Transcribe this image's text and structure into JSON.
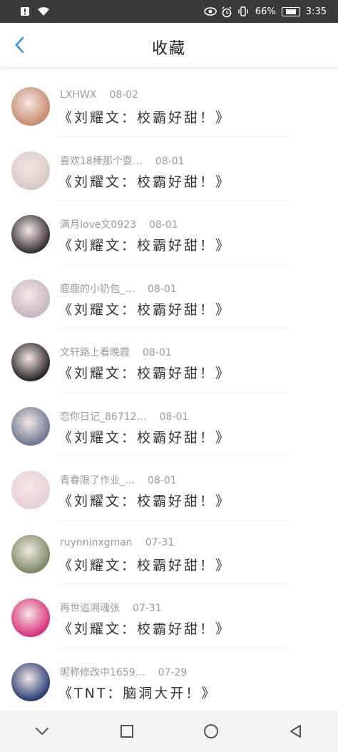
{
  "status_bar": {
    "battery_percent": "66%",
    "time": "3:35"
  },
  "header": {
    "title": "收藏"
  },
  "items": [
    {
      "author": "LXHWX",
      "date": "08-02",
      "title": "《刘耀文：校霸好甜！》",
      "avatar_color": "#c98b6d"
    },
    {
      "author": "喜欢18棒那个耍…",
      "date": "08-01",
      "title": "《刘耀文：校霸好甜！》",
      "avatar_color": "#d9c9c5"
    },
    {
      "author": "满月love文0923",
      "date": "08-01",
      "title": "《刘耀文：校霸好甜！》",
      "avatar_color": "#3b2f38"
    },
    {
      "author": "鹿鹿的小奶包_…",
      "date": "08-01",
      "title": "《刘耀文：校霸好甜！》",
      "avatar_color": "#c9b6c4"
    },
    {
      "author": "文轩路上看晚霞",
      "date": "08-01",
      "title": "《刘耀文：校霸好甜！》",
      "avatar_color": "#2b2628"
    },
    {
      "author": "恋你日记_86712…",
      "date": "08-01",
      "title": "《刘耀文：校霸好甜！》",
      "avatar_color": "#6c7a94"
    },
    {
      "author": "青春限了作业_…",
      "date": "08-01",
      "title": "《刘耀文：校霸好甜！》",
      "avatar_color": "#e9cfd9"
    },
    {
      "author": "ruynninxgman",
      "date": "07-31",
      "title": "《刘耀文：校霸好甜！》",
      "avatar_color": "#7d8a63"
    },
    {
      "author": "再世追溯魂张",
      "date": "07-31",
      "title": "《刘耀文：校霸好甜！》",
      "avatar_color": "#d9317e"
    },
    {
      "author": "昵称修改中1659…",
      "date": "07-29",
      "title": "《TNT：脑洞大开！》",
      "avatar_color": "#2a3f78"
    }
  ],
  "colors": {
    "accent": "#2e9bdb",
    "status_bar_bg": "#3a3a3a"
  },
  "icons": [
    "wifi-icon",
    "eye-icon",
    "alarm-icon",
    "vibrate-icon",
    "battery-icon",
    "back-icon",
    "nav-back-icon",
    "nav-home-icon",
    "nav-recents-icon"
  ]
}
